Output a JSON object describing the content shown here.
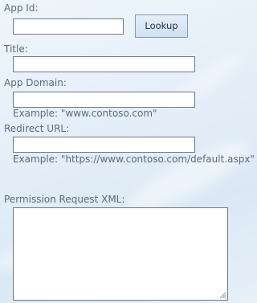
{
  "form": {
    "app_id": {
      "label": "App Id:",
      "value": ""
    },
    "lookup_button": {
      "label": "Lookup"
    },
    "title": {
      "label": "Title:",
      "value": ""
    },
    "app_domain": {
      "label": "App Domain:",
      "value": "",
      "example": "Example: \"www.contoso.com\""
    },
    "redirect_url": {
      "label": "Redirect URL:",
      "value": "",
      "example": "Example: \"https://www.contoso.com/default.aspx\""
    },
    "permission_xml": {
      "label": "Permission Request XML:",
      "value": ""
    }
  }
}
